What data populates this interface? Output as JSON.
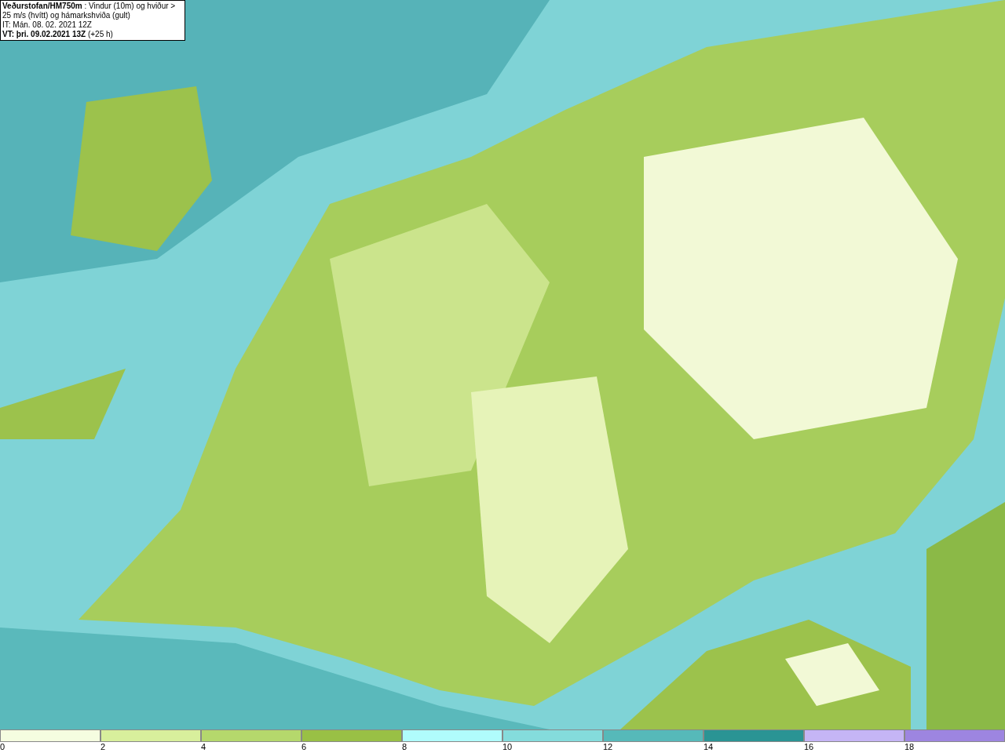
{
  "title_box": {
    "lines": [
      "**Veðurstofan/HM750m** : Vindur (10m) og hviður > 25 m/s (hvítt) og hámarkshviða (gult)",
      "IT: Mán. 08. 02. 2021 12Z",
      "**VT: þri. 09.02.2021 13Z** (+25 h)"
    ]
  },
  "legend": {
    "bins": [
      {
        "label": "0",
        "color": "#f5fde0"
      },
      {
        "label": "2",
        "color": "#d8ef9c"
      },
      {
        "label": "4",
        "color": "#b5d86c"
      },
      {
        "label": "6",
        "color": "#99c045"
      },
      {
        "label": "8",
        "color": "#b0fcfc"
      },
      {
        "label": "10",
        "color": "#84dcdc"
      },
      {
        "label": "12",
        "color": "#56b9b9"
      },
      {
        "label": "14",
        "color": "#2a9494"
      },
      {
        "label": "16",
        "color": "#c5b5f5"
      },
      {
        "label": "18",
        "color": "#9d85e0"
      }
    ]
  }
}
